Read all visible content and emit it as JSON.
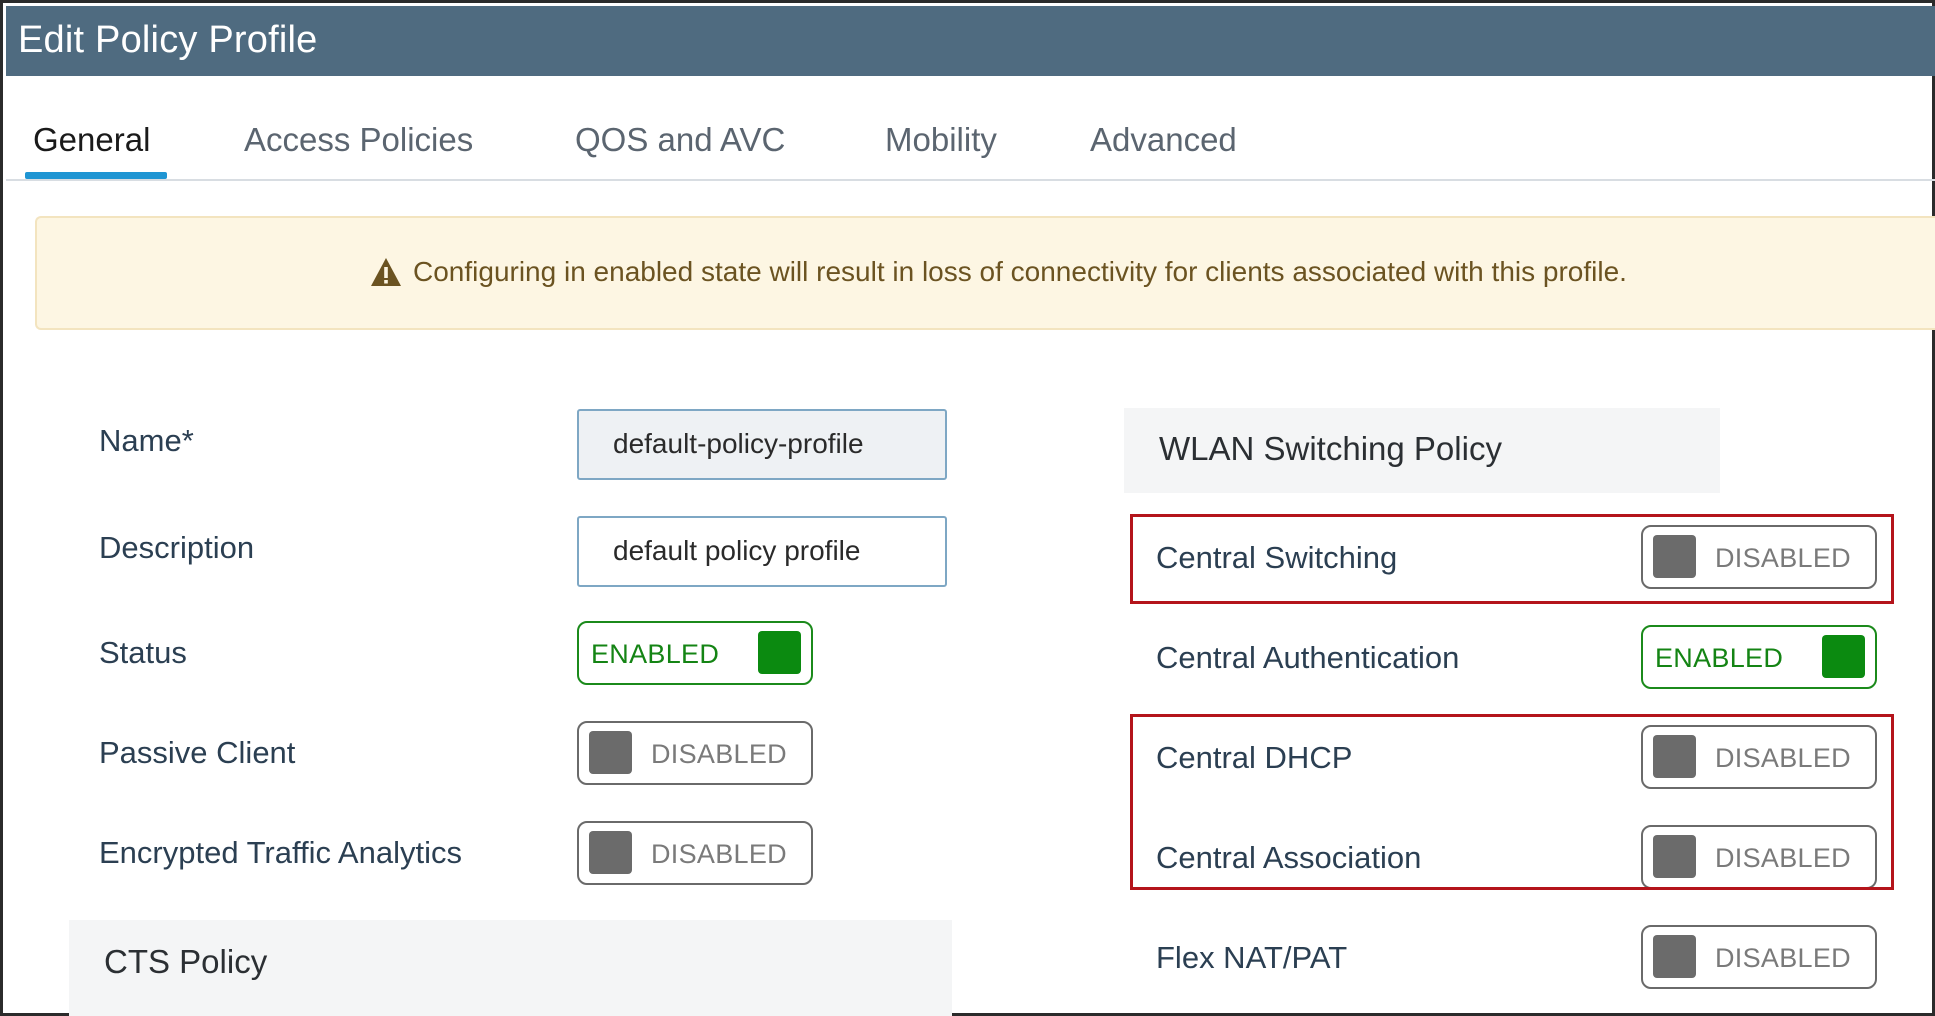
{
  "window": {
    "title": "Edit Policy Profile"
  },
  "tabs": [
    {
      "label": "General",
      "active": true
    },
    {
      "label": "Access Policies",
      "active": false
    },
    {
      "label": "QOS and AVC",
      "active": false
    },
    {
      "label": "Mobility",
      "active": false
    },
    {
      "label": "Advanced",
      "active": false
    }
  ],
  "alert": {
    "icon": "warning-triangle-icon",
    "message": "Configuring in enabled state will result in loss of connectivity for clients associated with this profile."
  },
  "general": {
    "name": {
      "label": "Name*",
      "value": "default-policy-profile"
    },
    "description": {
      "label": "Description",
      "value": "default policy profile"
    },
    "status": {
      "label": "Status",
      "state": "ENABLED"
    },
    "passive_client": {
      "label": "Passive Client",
      "state": "DISABLED"
    },
    "eta": {
      "label": "Encrypted Traffic Analytics",
      "state": "DISABLED"
    },
    "cts_policy": {
      "heading": "CTS Policy"
    }
  },
  "wlan_switching": {
    "heading": "WLAN Switching Policy",
    "central_switching": {
      "label": "Central Switching",
      "state": "DISABLED"
    },
    "central_authentication": {
      "label": "Central Authentication",
      "state": "ENABLED"
    },
    "central_dhcp": {
      "label": "Central DHCP",
      "state": "DISABLED"
    },
    "central_association": {
      "label": "Central Association",
      "state": "DISABLED"
    },
    "flex_nat_pat": {
      "label": "Flex NAT/PAT",
      "state": "DISABLED"
    }
  },
  "colors": {
    "titlebar": "#4f6b80",
    "tab_accent": "#1f95d3",
    "enabled_green": "#0b8a10",
    "disabled_gray": "#6b6b6b",
    "highlight_red": "#b4141b",
    "alert_bg": "#fdf6e3"
  }
}
